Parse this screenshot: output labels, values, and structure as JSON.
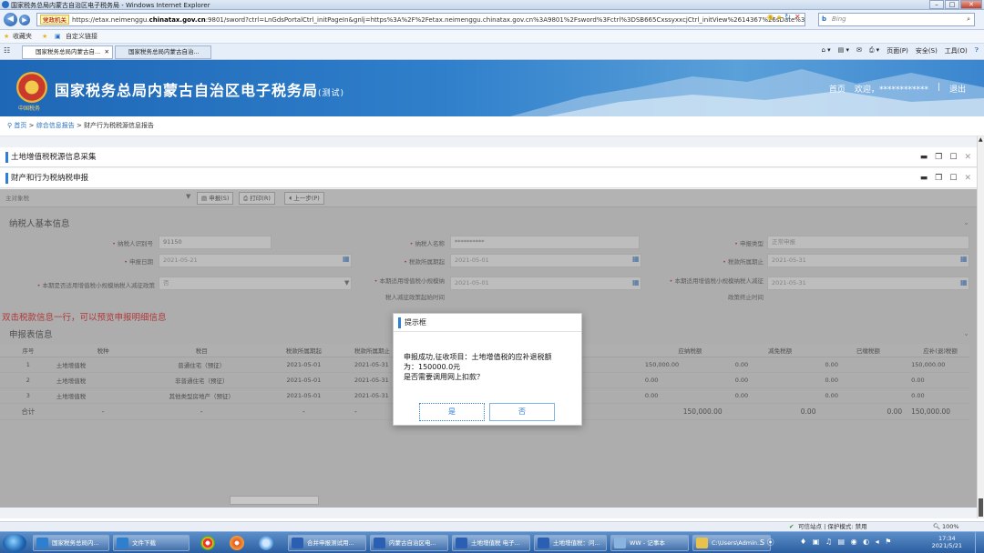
{
  "window": {
    "title": "国家税务总局内蒙古自治区电子税务局 - Windows Internet Explorer",
    "min": "–",
    "max": "□",
    "close": "✕"
  },
  "address": {
    "cert": "党政机关",
    "url_prefix": "https://etax.neimenggu.",
    "url_domain": "chinatax.gov.cn",
    "url_rest": ":9801/sword?ctrl=LnGdsPortalCtrl_initPageIn&gnlj=https%3A%2F%2Fetax.neimenggu.chinatax.gov.cn%3A9801%2Fsword%3Fctrl%3DSB665CxssyxxcjCtrl_initView%2614367%26sDate%3D",
    "search_placeholder": "Bing"
  },
  "favorites": {
    "label": "收藏夹",
    "link": "自定义链接"
  },
  "tabs": [
    {
      "label": "国家税务总局内蒙古自..."
    },
    {
      "label": "国家税务总局内蒙古自治..."
    }
  ],
  "ie_tools": [
    "页面(P)",
    "安全(S)",
    "工具(O)"
  ],
  "header": {
    "title": "国家税务总局内蒙古自治区电子税务局",
    "badge": "(测试)",
    "emblem_text": "中国税务",
    "home": "首页",
    "welcome": "欢迎，",
    "user": "************",
    "logout": "退出",
    "sep": "|"
  },
  "breadcrumb": {
    "home": "首页",
    "sep1": ">",
    "item1": "综合信息报告",
    "sep2": ">",
    "item2": "财产行为税税源信息报告"
  },
  "panels": [
    {
      "title": "土地增值税税源信息采集"
    },
    {
      "title": "财产和行为税纳税申报"
    }
  ],
  "toolbar": {
    "left": "主对象税",
    "declare": "申报(S)",
    "print": "打印(R)",
    "prev": "上一步(P)"
  },
  "sections": {
    "basic": "纳税人基本信息",
    "detail": "申报表信息"
  },
  "fields": [
    {
      "label": "纳税人识别号",
      "value": "91150"
    },
    {
      "label": "纳税人名称",
      "value": "**********"
    },
    {
      "label": "申报类型",
      "value": "正常申报"
    },
    {
      "label": "申报日期",
      "value": "2021-05-21"
    },
    {
      "label": "税款所属期起",
      "value": "2021-05-01"
    },
    {
      "label": "税款所属期止",
      "value": "2021-05-31"
    },
    {
      "label": "本期是否适用增值税小规模纳税人减征政策",
      "value": "否"
    },
    {
      "label_a": "本期适用增值税小规模纳",
      "label_b": "税人减征政策起始时间",
      "value": "2021-05-01"
    },
    {
      "label_a": "本期适用增值税小规模纳税人减征",
      "label_b": "政策终止时间",
      "value": "2021-05-31"
    }
  ],
  "hint": "双击税款信息一行，可以预览申报明细信息",
  "table": {
    "headers": [
      "序号",
      "税种",
      "税目",
      "税款所属期起",
      "税款所属期止",
      "",
      "",
      "应纳税额",
      "减免税额",
      "已缴税额",
      "应补(退)税额"
    ],
    "rows": [
      [
        "1",
        "土地增值税",
        "普通住宅（预征）",
        "2021-05-01",
        "2021-05-31",
        "",
        "",
        "150,000.00",
        "0.00",
        "0.00",
        "150,000.00"
      ],
      [
        "2",
        "土地增值税",
        "非普通住宅（预征）",
        "2021-05-01",
        "2021-05-31",
        "",
        "",
        "0.00",
        "0.00",
        "0.00",
        "0.00"
      ],
      [
        "3",
        "土地增值税",
        "其他类型房地产（预征）",
        "2021-05-01",
        "2021-05-31",
        "",
        "",
        "0.00",
        "0.00",
        "0.00",
        "0.00"
      ]
    ],
    "total": [
      "合计",
      "-",
      "-",
      "-",
      "-",
      "",
      "",
      "150,000.00",
      "0.00",
      "0.00",
      "150,000.00"
    ]
  },
  "dialog": {
    "title": "提示框",
    "line1": "申报成功,征收项目：土地增值税的应补退税额",
    "line2": "为：150000.0元",
    "line3": "是否需要调用网上扣款？",
    "yes": "是",
    "no": "否"
  },
  "status": {
    "zone": "可信站点 | 保护模式: 禁用",
    "zoom": "100%"
  },
  "taskbar": {
    "tasks": [
      {
        "label": "国家税务总局内...",
        "color": "#2d7fd0"
      },
      {
        "label": "文件下载",
        "color": "#2d7fd0"
      },
      {
        "label": "合并申报测试用...",
        "color": "#2b5fb4"
      },
      {
        "label": "内蒙古自治区电...",
        "color": "#2b5fb4"
      },
      {
        "label": "土地增值税 电子...",
        "color": "#2b5fb4"
      },
      {
        "label": "土地增值税：问...",
        "color": "#2b5fb4"
      },
      {
        "label": "WW - 记事本",
        "color": "#8ab4e0"
      },
      {
        "label": "C:\\Users\\Admin...",
        "color": "#e8c24a"
      }
    ],
    "time": "17:34",
    "date": "2021/5/21"
  }
}
